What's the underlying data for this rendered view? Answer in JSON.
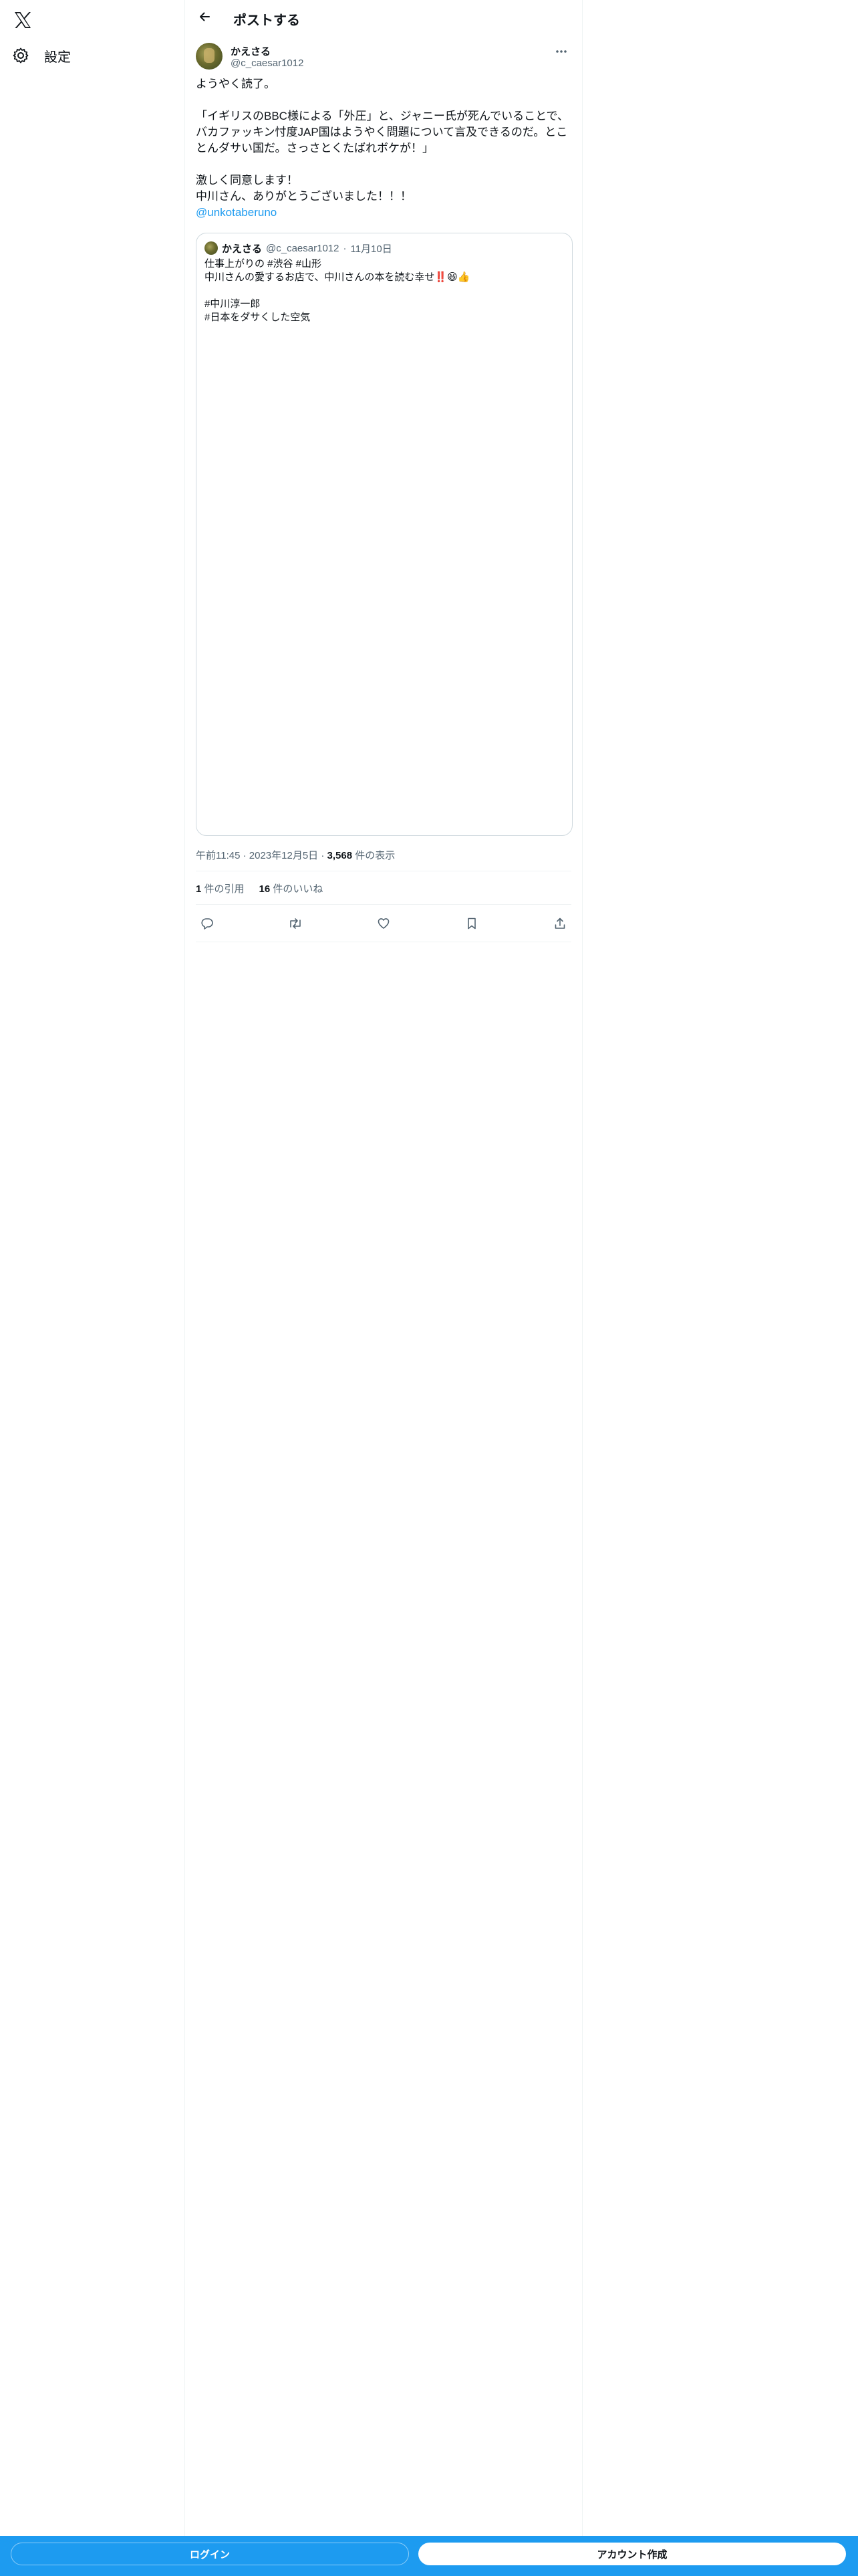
{
  "nav": {
    "settings_label": "設定",
    "logo_icon": "x-logo-icon",
    "settings_icon": "gear-icon"
  },
  "header": {
    "title": "ポストする",
    "back_icon": "arrow-left-icon"
  },
  "post": {
    "author_name": "かえさる",
    "author_handle": "@c_caesar1012",
    "lines": [
      "ようやく読了。",
      "",
      "「イギリスのBBC様による「外圧」と、ジャニー氏が死んでいることで、バカファッキン忖度JAP国はようやく問題について言及できるのだ。とことんダサい国だ。さっさとくたばれボケが！」",
      "",
      "激しく同意します！",
      "中川さん、ありがとうございました！！！"
    ],
    "mention": "@unkotaberuno",
    "time": "午前11:45",
    "date": "2023年12月5日",
    "views_count": "3,568",
    "views_label": "件の表示",
    "quotes_count": "1",
    "quotes_label": "件の引用",
    "likes_count": "16",
    "likes_label": "件のいいね"
  },
  "quote": {
    "author_name": "かえさる",
    "author_handle": "@c_caesar1012",
    "date": "11月10日",
    "lines": [
      "仕事上がりの #渋谷 #山形",
      "中川さんの愛するお店で、中川さんの本を読む幸せ‼️😆👍",
      "",
      "#中川淳一郎",
      "#日本をダサくした空気"
    ]
  },
  "bottom": {
    "login_label": "ログイン",
    "signup_label": "アカウント作成"
  },
  "colors": {
    "accent": "#1d9bf0",
    "text": "#0f1419",
    "muted": "#536471",
    "border": "#cfd9de"
  }
}
